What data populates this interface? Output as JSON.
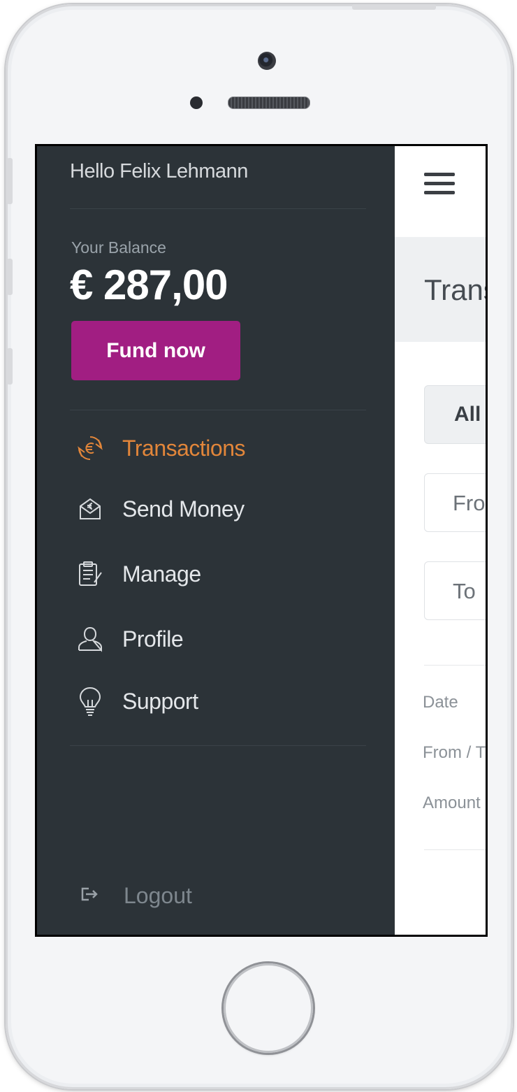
{
  "drawer": {
    "greeting": "Hello Felix Lehmann",
    "balance_label": "Your Balance",
    "balance_amount": "€ 287,00",
    "fund_button": "Fund now",
    "nav": [
      {
        "label": "Transactions",
        "icon": "euro-cycle-icon",
        "active": true
      },
      {
        "label": "Send Money",
        "icon": "envelope-euro-icon",
        "active": false
      },
      {
        "label": "Manage",
        "icon": "clipboard-icon",
        "active": false
      },
      {
        "label": "Profile",
        "icon": "user-icon",
        "active": false
      },
      {
        "label": "Support",
        "icon": "lightbulb-icon",
        "active": false
      }
    ],
    "logout": "Logout"
  },
  "content": {
    "menu_icon": "hamburger-menu-icon",
    "title": "Trans",
    "filter_pill": "All",
    "from_field": "Fro",
    "to_field": "To",
    "columns": [
      "Date",
      "From / T",
      "Amount"
    ]
  },
  "colors": {
    "drawer_bg": "#2c3338",
    "accent_purple": "#a11e82",
    "active_orange": "#e2863a"
  }
}
